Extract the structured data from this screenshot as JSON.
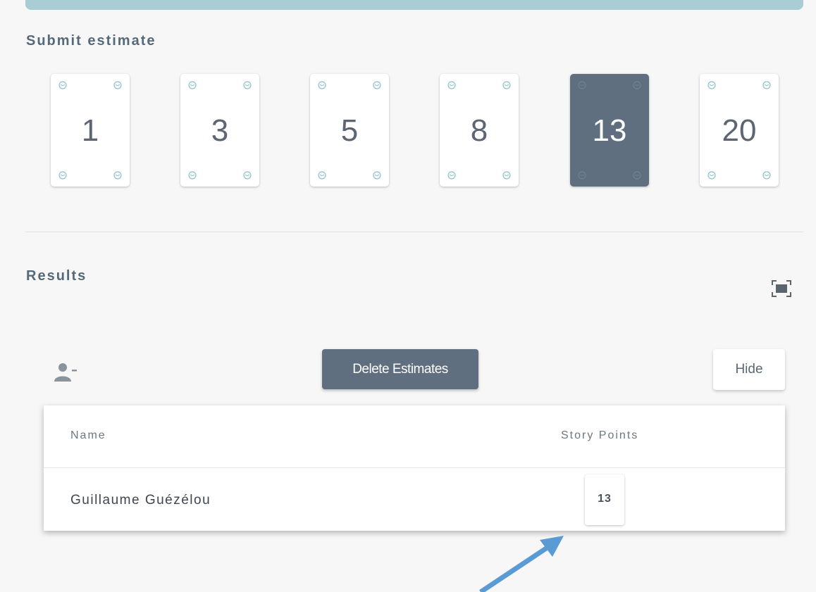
{
  "estimate": {
    "title": "Submit estimate",
    "cards": [
      {
        "value": "1",
        "selected": false
      },
      {
        "value": "3",
        "selected": false
      },
      {
        "value": "5",
        "selected": false
      },
      {
        "value": "8",
        "selected": false
      },
      {
        "value": "13",
        "selected": true
      },
      {
        "value": "20",
        "selected": false
      }
    ],
    "card_corner_icon": "coffee-cup-icon"
  },
  "results": {
    "title": "Results",
    "delete_label": "Delete Estimates",
    "hide_label": "Hide",
    "icons": {
      "expand": "fullscreen-icon",
      "remove_user": "remove-user-icon"
    },
    "table": {
      "columns": [
        "Name",
        "Story Points"
      ],
      "rows": [
        {
          "name": "Guillaume Guézélou",
          "points": "13"
        }
      ]
    }
  },
  "colors": {
    "accent": "#5f6f80",
    "top_bar": "#a8cdd5",
    "annotation_arrow": "#5b9bd5"
  }
}
